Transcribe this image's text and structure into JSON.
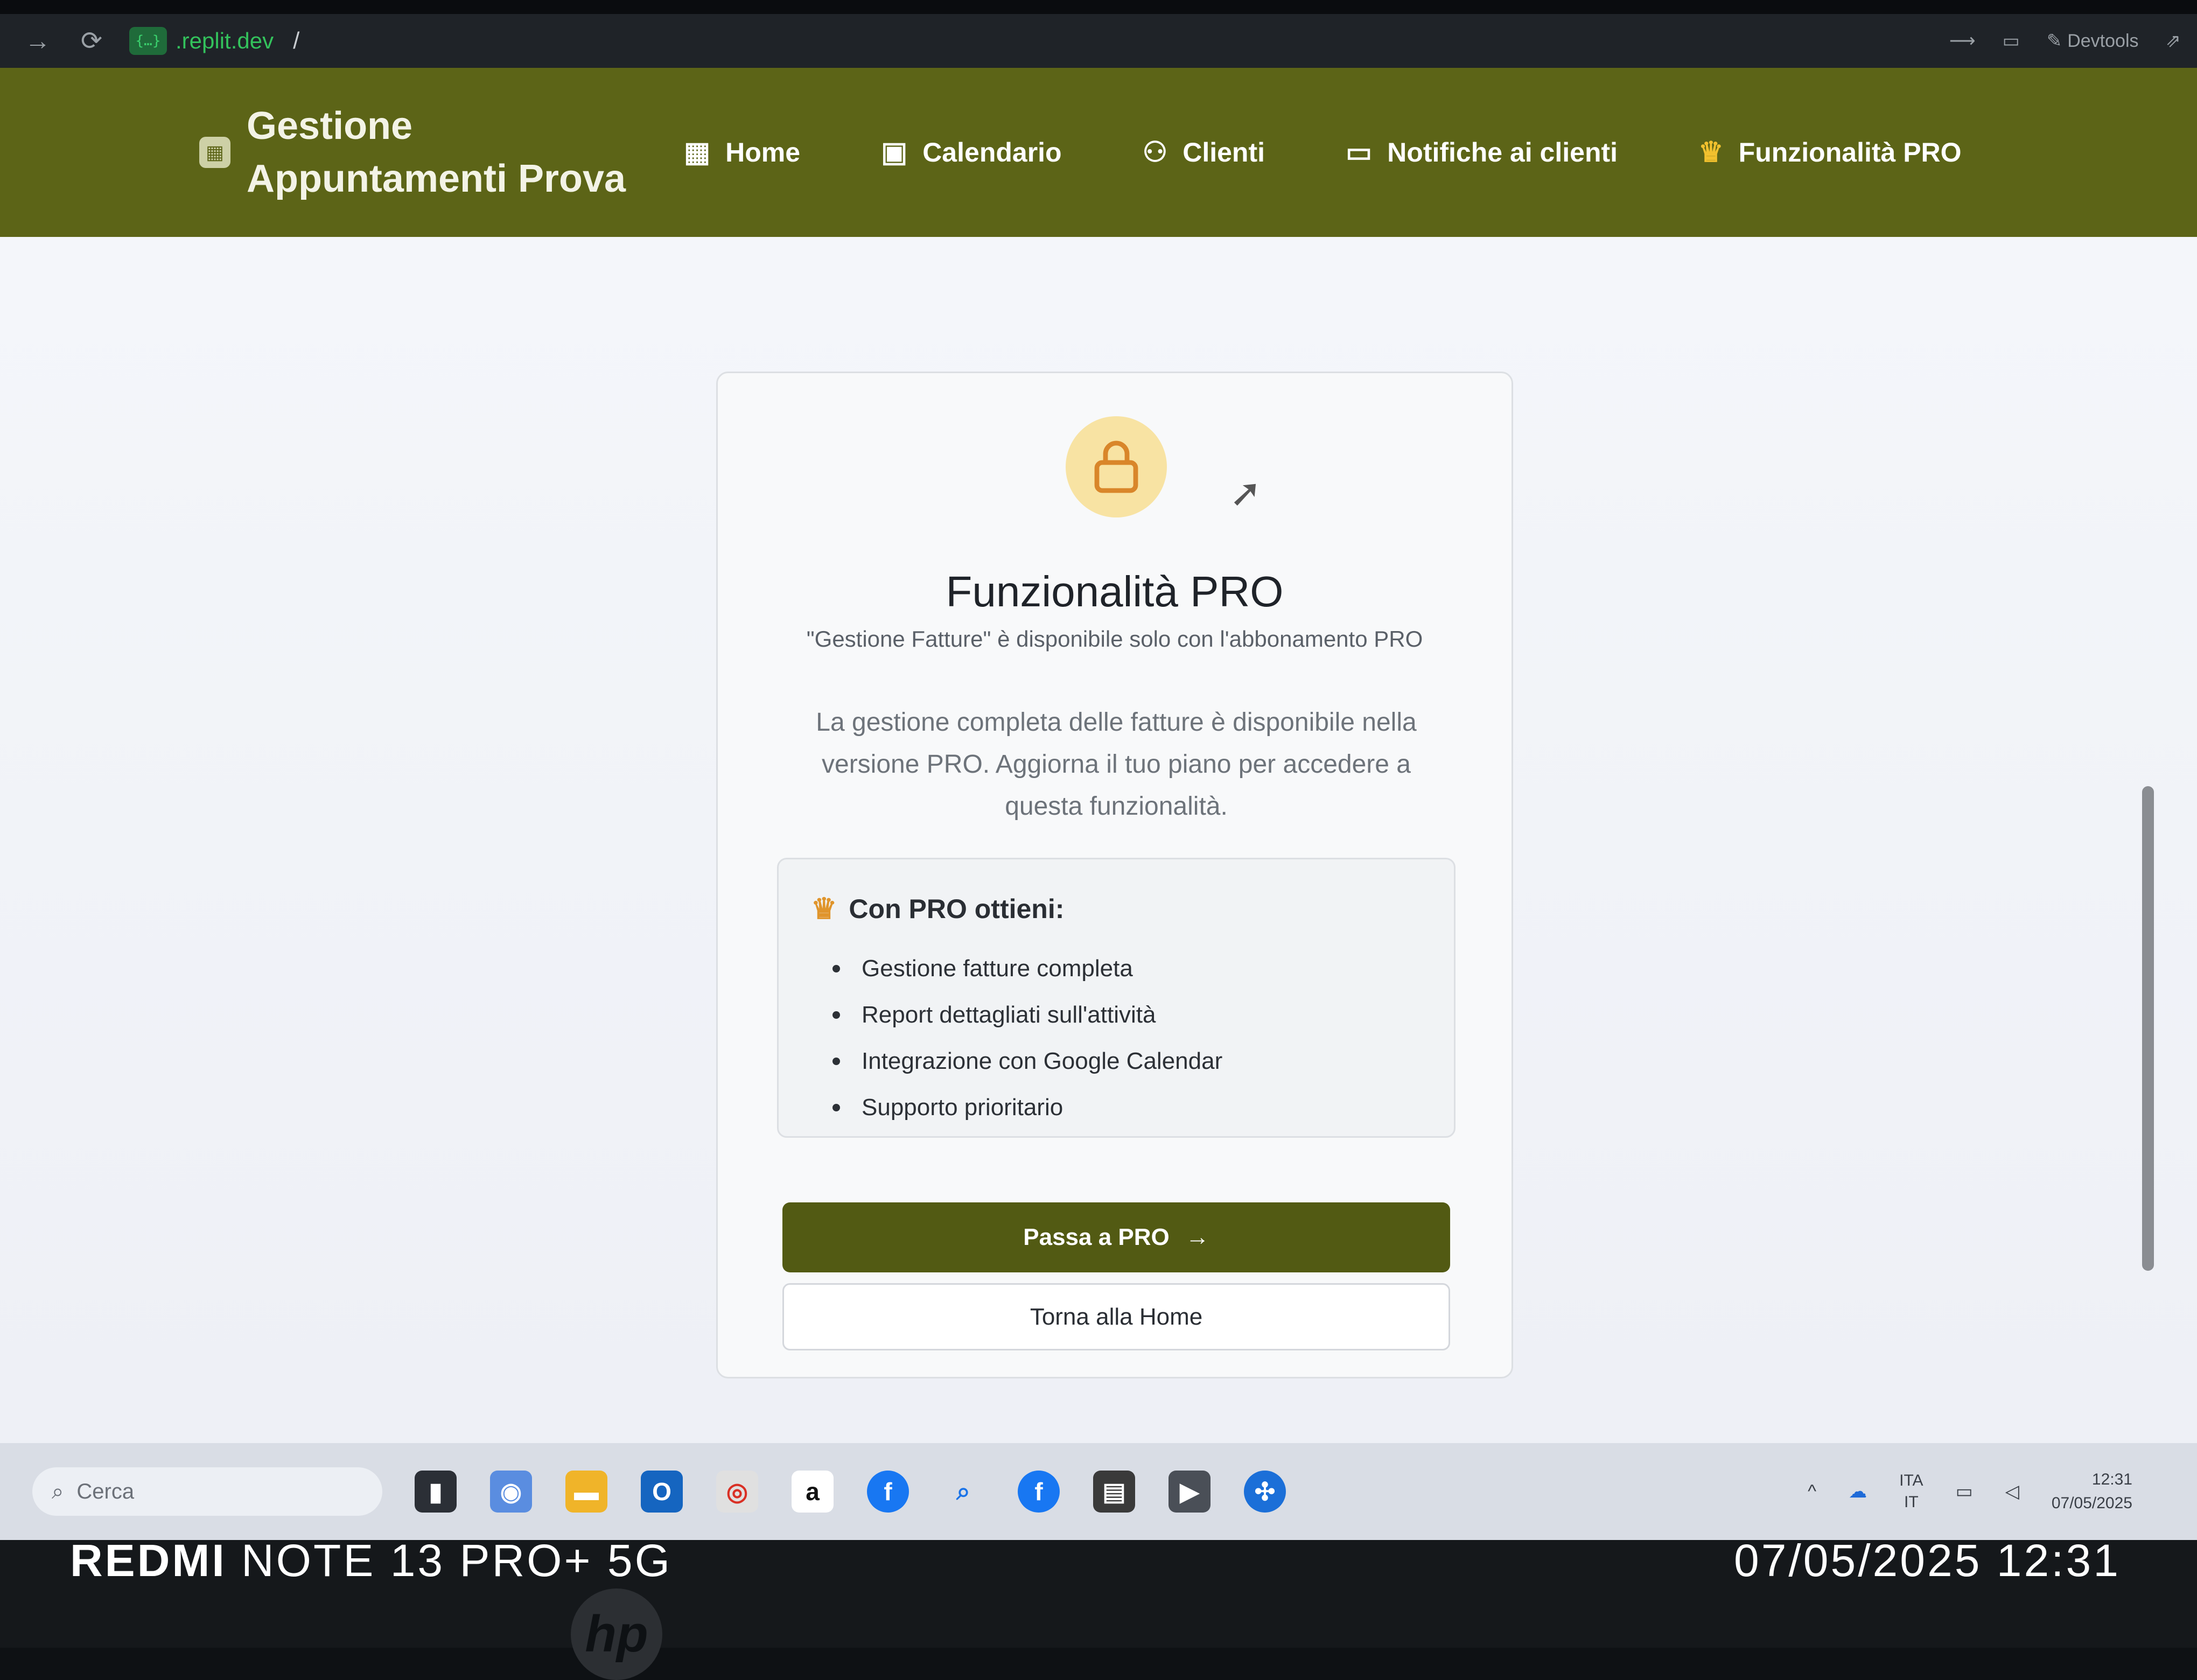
{
  "browser": {
    "url_host": ".replit.dev",
    "url_path": "/",
    "devtools_label": "Devtools"
  },
  "app": {
    "title": "Gestione Appuntamenti Prova",
    "nav": [
      {
        "label": "Home",
        "icon": "grid-icon"
      },
      {
        "label": "Calendario",
        "icon": "calendar-icon"
      },
      {
        "label": "Clienti",
        "icon": "users-icon"
      },
      {
        "label": "Notifiche ai clienti",
        "icon": "message-icon"
      },
      {
        "label": "Funzionalità PRO",
        "icon": "crown-icon"
      }
    ]
  },
  "card": {
    "title": "Funzionalità PRO",
    "subtitle": "\"Gestione Fatture\" è disponibile solo con l'abbonamento PRO",
    "description": "La gestione completa delle fatture è disponibile nella versione PRO. Aggiorna il tuo piano per accedere a questa funzionalità.",
    "benefits_title": "Con PRO ottieni:",
    "benefits": [
      "Gestione fatture completa",
      "Report dettagliati sull'attività",
      "Integrazione con Google Calendar",
      "Supporto prioritario"
    ],
    "primary_button": "Passa a PRO",
    "secondary_button": "Torna alla Home"
  },
  "taskbar": {
    "search_placeholder": "Cerca",
    "language": "ITA",
    "region": "IT",
    "time": "12:31",
    "date": "07/05/2025"
  },
  "watermark": {
    "brand": "REDMI",
    "model": "NOTE 13 PRO+ 5G",
    "datetime": "07/05/2025 12:31"
  },
  "colors": {
    "nav_bg": "#5c6417",
    "primary_button": "#525a13",
    "lock_circle": "#f8e3a3",
    "crown": "#e0952c"
  }
}
